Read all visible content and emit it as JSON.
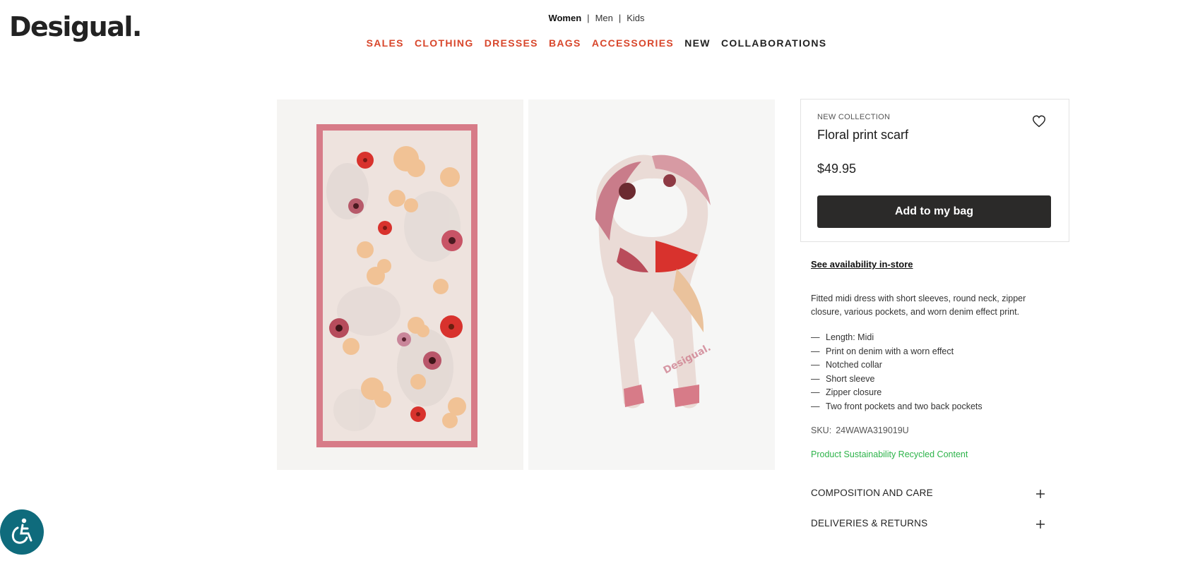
{
  "brand": {
    "logo": "Desigual."
  },
  "gender_nav": {
    "women": "Women",
    "men": "Men",
    "kids": "Kids"
  },
  "main_nav": [
    "SALES",
    "CLOTHING",
    "DRESSES",
    "BAGS",
    "ACCESSORIES",
    "NEW",
    "COLLABORATIONS"
  ],
  "product": {
    "kicker": "NEW COLLECTION",
    "title": "Floral print scarf",
    "price": "$49.95",
    "add_to_bag": "Add to my bag",
    "availability": "See availability in-store",
    "description": "Fitted midi dress with short sleeves, round neck, zipper closure, various pockets, and worn denim effect print.",
    "features": [
      "Length: Midi",
      "Print on denim with a worn effect",
      "Notched collar",
      "Short sleeve",
      "Zipper closure",
      "Two front pockets and two back pockets"
    ],
    "sku_label": "SKU:",
    "sku_value": "24WAWA319019U",
    "sustainability": "Product Sustainability Recycled Content",
    "watermark": "Desigual."
  },
  "accordions": {
    "composition": "COMPOSITION AND CARE",
    "delivery": "DELIVERIES & RETURNS"
  },
  "icons": {
    "wishlist": "heart-icon",
    "expand": "plus-icon",
    "accessibility": "accessibility-icon"
  },
  "colors": {
    "nav_red": "#d8462b",
    "button_dark": "#2b2a29",
    "sustain_green": "#2db34a",
    "a11y_teal": "#0f6b7c"
  }
}
